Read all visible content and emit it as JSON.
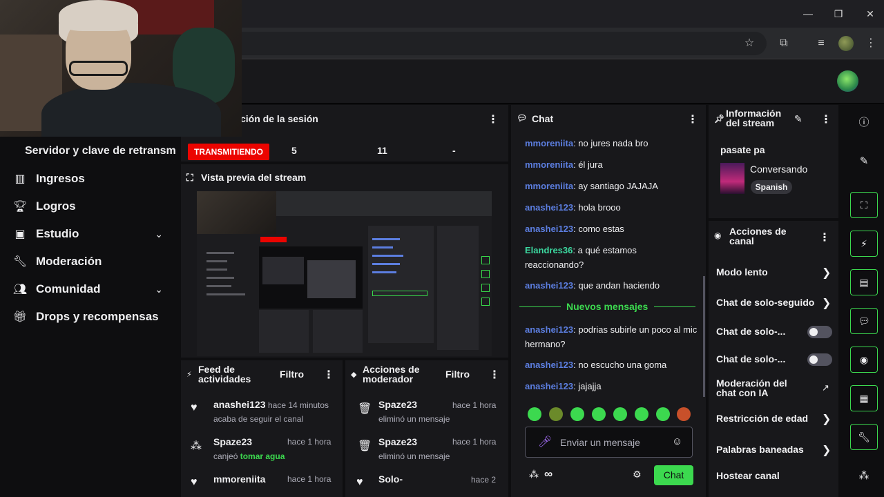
{
  "browser": {
    "window_controls": {
      "minimize": "—",
      "maximize": "❐",
      "close": "✕"
    }
  },
  "sidebar": {
    "title": "Servidor y clave de retransm",
    "items": [
      {
        "label": "Ingresos",
        "icon": "bar-chart-icon"
      },
      {
        "label": "Logros",
        "icon": "trophy-icon"
      },
      {
        "label": "Estudio",
        "icon": "studio-icon",
        "expandable": true
      },
      {
        "label": "Moderación",
        "icon": "wrench-icon"
      },
      {
        "label": "Comunidad",
        "icon": "people-icon",
        "expandable": true
      },
      {
        "label": "Drops y recompensas",
        "icon": "gift-icon"
      }
    ]
  },
  "session": {
    "title": "ción de la sesión",
    "live_badge": "TRANSMITIENDO",
    "stat1": "5",
    "stat2": "11",
    "stat3": "-"
  },
  "preview": {
    "title": "Vista previa del stream"
  },
  "activity_feed": {
    "title": "Feed de actividades",
    "filter": "Filtro",
    "rows": [
      {
        "name": "anashei123",
        "time": "hace 14 minutos",
        "sub": "acaba de seguir el canal",
        "icon": "heart-icon"
      },
      {
        "name": "Spaze23",
        "time": "hace 1 hora",
        "sub_prefix": "canjeó ",
        "sub_highlight": "tomar agua",
        "icon": "points-icon"
      },
      {
        "name": "mmoreniita",
        "time": "hace 1 hora",
        "icon": "heart-icon"
      }
    ]
  },
  "mod_actions": {
    "title": "Acciones de moderador",
    "filter": "Filtro",
    "rows": [
      {
        "name": "Spaze23",
        "time": "hace 1 hora",
        "sub": "eliminó un mensaje",
        "icon": "trash-icon"
      },
      {
        "name": "Spaze23",
        "time": "hace 1 hora",
        "sub": "eliminó un mensaje",
        "icon": "trash-icon"
      },
      {
        "name": "Solo-",
        "time": "hace 2",
        "icon": "heart-icon"
      }
    ]
  },
  "chat": {
    "title": "Chat",
    "messages": [
      {
        "user": "mmoreniita",
        "text": ": no jures nada bro",
        "color": "#5c7ee0"
      },
      {
        "user": "mmoreniita",
        "text": ": él jura",
        "color": "#5c7ee0"
      },
      {
        "user": "mmoreniita",
        "text": ": ay santiago JAJAJA",
        "color": "#5c7ee0"
      },
      {
        "user": "anashei123",
        "text": ": hola brooo",
        "color": "#5c7ee0"
      },
      {
        "user": "anashei123",
        "text": ": como estas",
        "color": "#5c7ee0"
      },
      {
        "user": "Elandres36",
        "text": ": a qué estamos reaccionando?",
        "color": "#3cd9a0"
      },
      {
        "user": "anashei123",
        "text": ": que andan haciendo",
        "color": "#5c7ee0"
      },
      {
        "user": "anashei123",
        "text": ": podrias subirle un poco al mic hermano?",
        "color": "#5c7ee0"
      },
      {
        "user": "anashei123",
        "text": ": no escucho una goma",
        "color": "#5c7ee0"
      },
      {
        "user": "anashei123",
        "text": ": jajajja",
        "color": "#5c7ee0"
      }
    ],
    "new_messages": "Nuevos mensajes",
    "input_placeholder": "Enviar un mensaje",
    "points": "∞",
    "send": "Chat"
  },
  "stream_info": {
    "title": "Información del stream",
    "stream_title": "pasate pa",
    "category": "Conversando",
    "language": "Spanish"
  },
  "channel_actions": {
    "title": "Acciones de canal",
    "items": [
      {
        "label": "Modo lento",
        "control": "chevron"
      },
      {
        "label": "Chat de solo-seguido",
        "control": "chevron"
      },
      {
        "label": "Chat de solo-...",
        "control": "toggle"
      },
      {
        "label": "Chat de solo-...",
        "control": "toggle"
      },
      {
        "label": "Moderación del chat con IA",
        "control": "external"
      },
      {
        "label": "Restricción de edad",
        "control": "chevron"
      },
      {
        "label": "Palabras baneadas",
        "control": "chevron"
      },
      {
        "label": "Hostear canal",
        "control": "none"
      }
    ]
  },
  "colors": {
    "accent": "#3cd94f",
    "live": "#eb0400",
    "username": "#5c7ee0"
  }
}
